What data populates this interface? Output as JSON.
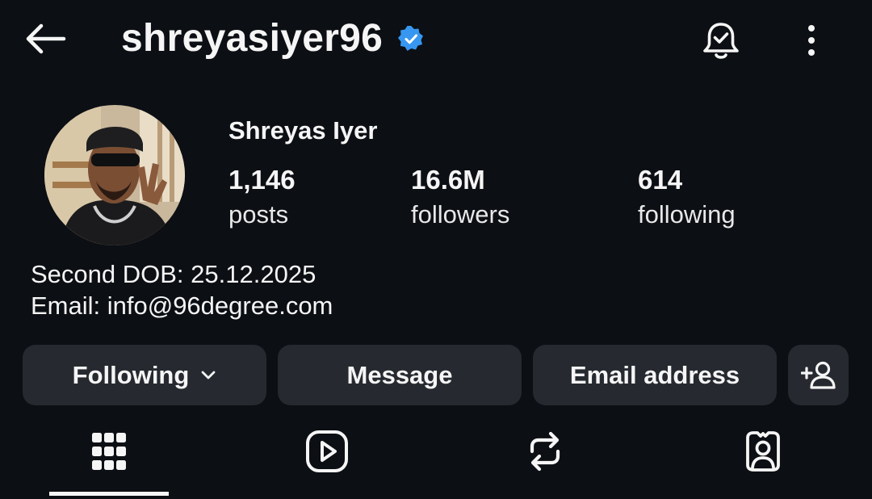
{
  "header": {
    "username": "shreyasiyer96",
    "icons": {
      "back": "back-arrow-icon",
      "verified": "verified-badge-icon",
      "notifications": "bell-check-icon",
      "more": "more-vertical-icon"
    }
  },
  "profile": {
    "full_name": "Shreyas Iyer",
    "stats": [
      {
        "value": "1,146",
        "label": "posts"
      },
      {
        "value": "16.6M",
        "label": "followers"
      },
      {
        "value": "614",
        "label": "following"
      }
    ],
    "bio": [
      "Second DOB: 25.12.2025",
      "Email: info@96degree.com"
    ]
  },
  "actions": {
    "following_label": "Following",
    "message_label": "Message",
    "email_label": "Email address",
    "icons": {
      "following_dropdown": "chevron-down-icon",
      "add_user": "add-user-icon"
    }
  },
  "tabs": [
    {
      "name": "posts-grid",
      "icon": "grid-icon",
      "selected": true
    },
    {
      "name": "reels",
      "icon": "reels-icon",
      "selected": false
    },
    {
      "name": "reposts",
      "icon": "repost-icon",
      "selected": false
    },
    {
      "name": "tagged",
      "icon": "tagged-user-icon",
      "selected": false
    }
  ],
  "colors": {
    "background": "#0c0f14",
    "button_bg": "#262a30",
    "verified_blue": "#3797f0",
    "text": "#f5f5f5"
  }
}
